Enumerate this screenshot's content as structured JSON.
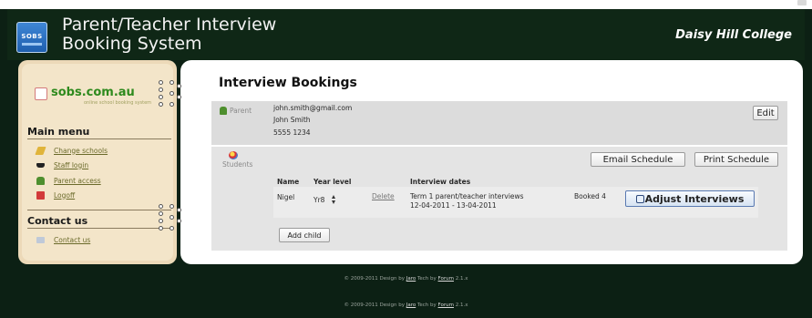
{
  "header": {
    "logo_text": "SOBS",
    "title_line1": "Parent/Teacher Interview",
    "title_line2": "Booking System",
    "college": "Daisy Hill College"
  },
  "sidebar": {
    "brand": "sobs.com.au",
    "brand_tagline": "online school booking system",
    "main_menu_heading": "Main menu",
    "menu_items": [
      {
        "label": "Change schools",
        "icon": "pencil-icon",
        "color": "#e0b43a"
      },
      {
        "label": "Staff login",
        "icon": "hat-icon",
        "color": "#222222"
      },
      {
        "label": "Parent access",
        "icon": "people-icon",
        "color": "#4e8f2e"
      },
      {
        "label": "Logoff",
        "icon": "logoff-icon",
        "color": "#d23a3a"
      }
    ],
    "contact_heading": "Contact us",
    "contact_item": {
      "label": "Contact us",
      "icon": "envelope-icon",
      "color": "#bfc9d8"
    }
  },
  "main": {
    "title": "Interview Bookings",
    "parent": {
      "label": "Parent",
      "email": "john.smith@gmail.com",
      "name": "John Smith",
      "phone": "5555 1234",
      "edit_label": "Edit"
    },
    "students": {
      "label": "Students",
      "email_schedule_label": "Email Schedule",
      "print_schedule_label": "Print Schedule",
      "columns": [
        "Name",
        "Year level",
        "Interview dates"
      ],
      "rows": [
        {
          "name": "Nigel",
          "year_level": "Yr8",
          "delete_label": "Delete",
          "interview_line1": "Term 1 parent/teacher interviews",
          "interview_line2": "12-04-2011 - 13-04-2011",
          "booked": "Booked 4",
          "adjust_label": "Adjust Interviews"
        }
      ],
      "add_child_label": "Add child"
    }
  },
  "footer": {
    "line1_prefix": "© 2009-2011 Design by",
    "line1_design": "Jaro",
    "line1_mid": "Tech by",
    "line1_tech": "Forum",
    "line1_suffix": "2.1.x",
    "line2_prefix": "© 2009-2011 Design by",
    "line2_design": "Jaro",
    "line2_mid": "Tech by",
    "line2_tech": "Forum",
    "line2_suffix": "2.1.x"
  },
  "colors": {
    "background": "#0c2014",
    "sidebar": "#f3e5c9",
    "brand_green": "#2e8a1d",
    "panel_grey": "#dcdcdc"
  }
}
